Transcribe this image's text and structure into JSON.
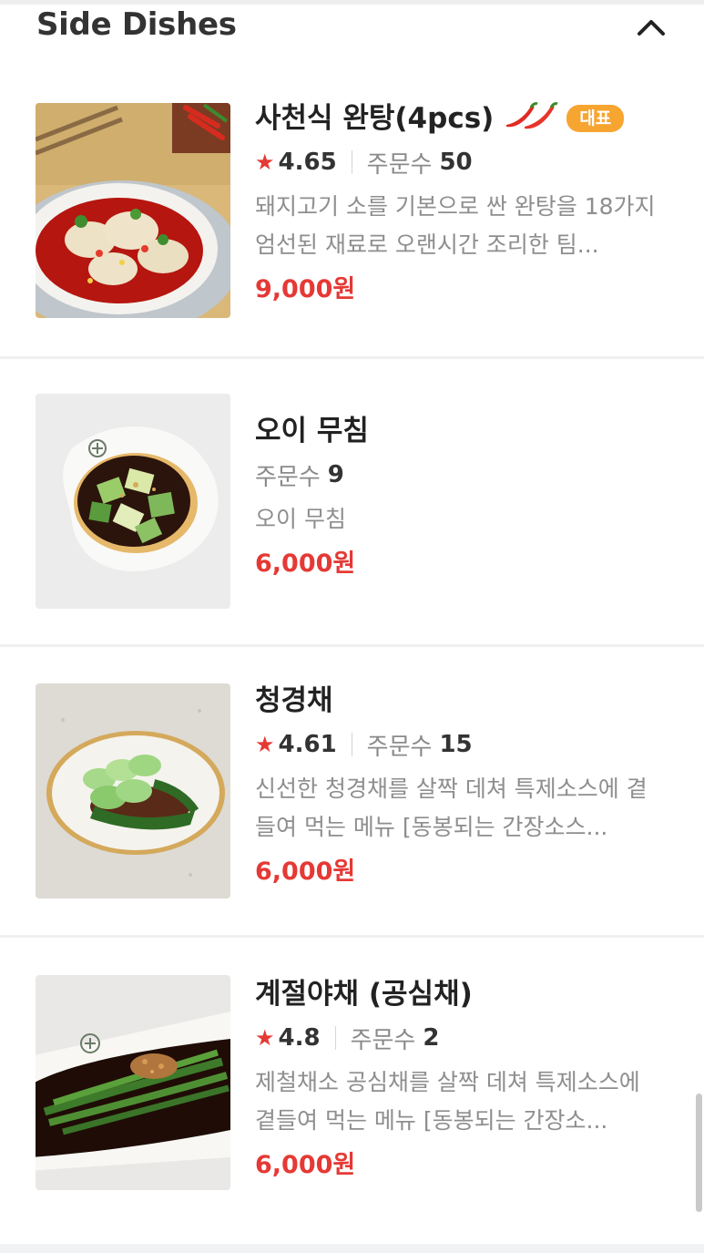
{
  "section": {
    "title": "Side Dishes",
    "collapse_icon": "chevron-up-icon"
  },
  "items": [
    {
      "name": "사천식 완탕(4pcs)",
      "spicy_icon": "chili-pepper-icon",
      "badge": "대표",
      "rating": "4.65",
      "orders_label": "주문수",
      "orders": "50",
      "description": "돼지고기 소를 기본으로 싼 완탕을 18가지 엄선된 재료로 오랜시간 조리한 팀...",
      "price": "9,000원"
    },
    {
      "name": "오이 무침",
      "orders_label": "주문수",
      "orders": "9",
      "description": "오이 무침",
      "price": "6,000원"
    },
    {
      "name": "청경채",
      "rating": "4.61",
      "orders_label": "주문수",
      "orders": "15",
      "description": "신선한 청경채를 살짝 데쳐 특제소스에 곁들여 먹는 메뉴 [동봉되는 간장소스...",
      "price": "6,000원"
    },
    {
      "name": "계절야채 (공심채)",
      "rating": "4.8",
      "orders_label": "주문수",
      "orders": "2",
      "description": "제철채소 공심채를 살짝 데쳐 특제소스에 곁들여 먹는 메뉴 [동봉되는 간장소...",
      "price": "6,000원"
    }
  ],
  "colors": {
    "price": "#e53935",
    "star": "#e53935",
    "badge": "#f7a531",
    "title": "#333333",
    "muted": "#8e8e8e"
  }
}
